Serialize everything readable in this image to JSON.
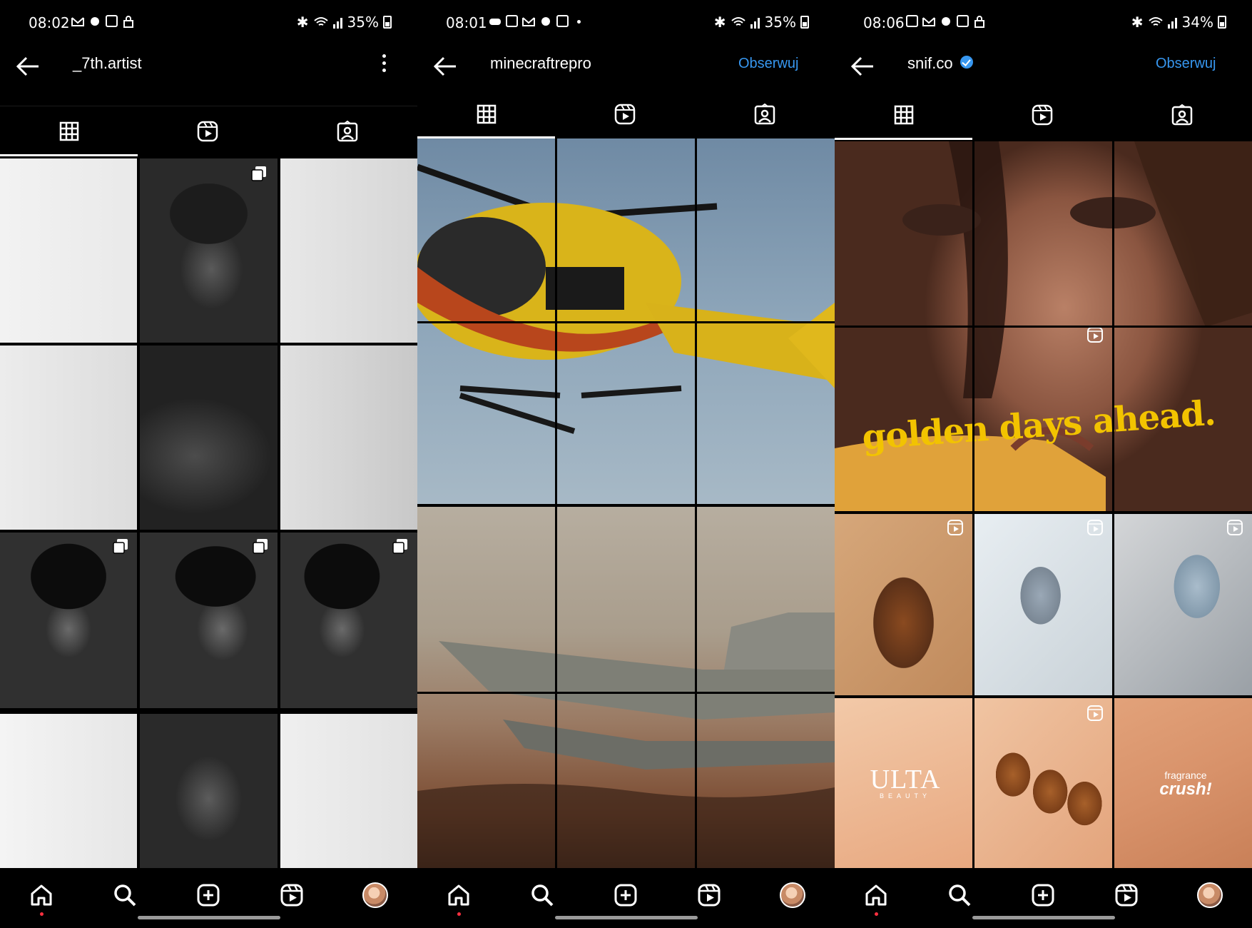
{
  "phones": [
    {
      "status": {
        "time": "08:02",
        "battery": "35%"
      },
      "header": {
        "username": "_7th.artist"
      },
      "tabs": [
        "grid",
        "reels",
        "tagged"
      ],
      "nav": [
        "home",
        "search",
        "create",
        "reels",
        "profile"
      ]
    },
    {
      "status": {
        "time": "08:01",
        "battery": "35%"
      },
      "header": {
        "username": "minecraftrepro",
        "follow_label": "Obserwuj"
      },
      "tabs": [
        "grid",
        "reels",
        "tagged"
      ],
      "nav": [
        "home",
        "search",
        "create",
        "reels",
        "profile"
      ]
    },
    {
      "status": {
        "time": "08:06",
        "battery": "34%"
      },
      "header": {
        "username": "snif.co",
        "follow_label": "Obserwuj",
        "verified": true
      },
      "tabs": [
        "grid",
        "reels",
        "tagged"
      ],
      "nav": [
        "home",
        "search",
        "create",
        "reels",
        "profile"
      ],
      "posts": {
        "headline": "golden days ahead.",
        "ulta_logo": "ULTA",
        "ulta_sub": "BEAUTY",
        "fragrance_line1": "fragrance",
        "fragrance_line2": "crush!"
      }
    }
  ],
  "colors": {
    "accent": "#3797f0",
    "background": "#000000",
    "notification": "#ff3040"
  }
}
